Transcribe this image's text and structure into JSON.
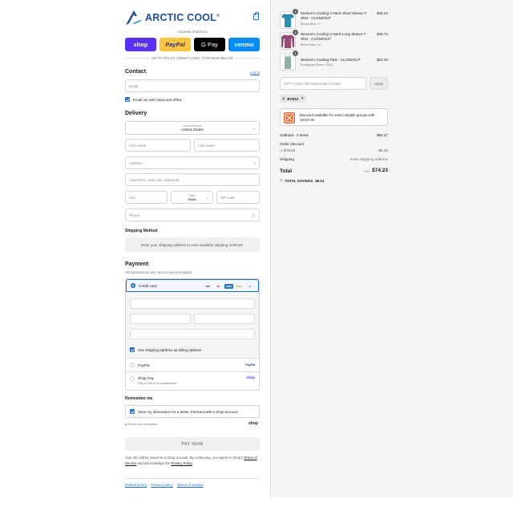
{
  "brand": {
    "name": "ARCTIC COOL",
    "trademark": "®",
    "accent": "#1e4fa0",
    "link_color": "#1e6fd9"
  },
  "express": {
    "label": "Express checkout",
    "buttons": [
      {
        "label": "shop",
        "color": "#5a31f4"
      },
      {
        "label": "PayPal",
        "color": "#ffc439"
      },
      {
        "label": "G Pay",
        "color": "#000000"
      },
      {
        "label": "venmo",
        "color": "#008cff"
      }
    ],
    "or_text": "OR TO PAY BY CREDIT CARD, CONTINUE BELOW"
  },
  "contact": {
    "title": "Contact",
    "login_label": "Log in",
    "email_placeholder": "Email",
    "news_label": "Email me with news and offers"
  },
  "delivery": {
    "title": "Delivery",
    "country_label": "Country/Region",
    "country_value": "United States",
    "first_name": "First name",
    "last_name": "Last name",
    "address": "Address",
    "apartment": "Apartment, suite, etc. (optional)",
    "city": "City",
    "state_label": "State",
    "state_value": "Iowa",
    "zip": "ZIP code",
    "phone": "Phone"
  },
  "shipping_method": {
    "title": "Shipping Method",
    "info": "Enter your shipping address to view available shipping methods."
  },
  "payment": {
    "title": "Payment",
    "subtitle": "All transactions are secure and encrypted.",
    "credit_card_label": "Credit card",
    "card_brands": [
      "VISA",
      "MC",
      "AMEX",
      "DISC",
      "+4"
    ],
    "billing_same_label": "Use shipping address as billing address",
    "paypal_label": "PayPal",
    "paypal_logo": "PayPal",
    "shop_pay_label": "Shop Pay",
    "shop_pay_sub": "Pay in full or in installments",
    "shop_pay_logo": "shop"
  },
  "remember": {
    "title": "Remember me",
    "save_label": "Save my information for a faster checkout with a Shop account",
    "secure_text": "Secure and encrypted",
    "shop_logo": "shop"
  },
  "pay_now": "PAY NOW",
  "fine_print": {
    "pre": "Your info will be saved to a Shop account. By continuing, you agree to Shop's ",
    "terms": "Terms of Service",
    "mid": " and acknowledge the ",
    "privacy": "Privacy Policy",
    "end": "."
  },
  "footer": {
    "refund": "Refund policy",
    "privacy": "Privacy policy",
    "terms": "Terms of service"
  },
  "cart": {
    "items": [
      {
        "qty": "1",
        "name": "Women's Cooling V-Neck Short Sleeve T-Shirt - CLOSEOUT",
        "variant": "Bonsai Blue / S",
        "price": "$26.24",
        "color": "#2b8fb3"
      },
      {
        "qty": "1",
        "name": "Women's Cooling V-Neck Long Sleeve T-Shirt - CLOSEOUT",
        "variant": "Blush Rose / XL",
        "price": "$33.74",
        "color": "#9c4a78"
      },
      {
        "qty": "1",
        "name": "Women's Cooling Tank - CLOSEOUT",
        "variant": "Eucalyptus Green / XXXL",
        "price": "$22.49",
        "color": "#8fb3a3"
      }
    ],
    "discount_placeholder": "GIFT CARD OR DISCOUNT CODE",
    "apply_label": "Apply",
    "applied_code": "BYE10",
    "govx_text": "Discount available for select eligible groups with GOVX ID",
    "subtotal_label": "Subtotal · 3 items",
    "subtotal_value": "$82.47",
    "order_discount_label": "Order discount",
    "discount_code": "BYE10",
    "discount_value": "- $8.24",
    "shipping_label": "Shipping",
    "shipping_value": "Enter shipping address",
    "total_label": "Total",
    "currency": "USD",
    "total_value": "$74.23",
    "savings_label": "TOTAL SAVINGS",
    "savings_value": "$8.24"
  }
}
